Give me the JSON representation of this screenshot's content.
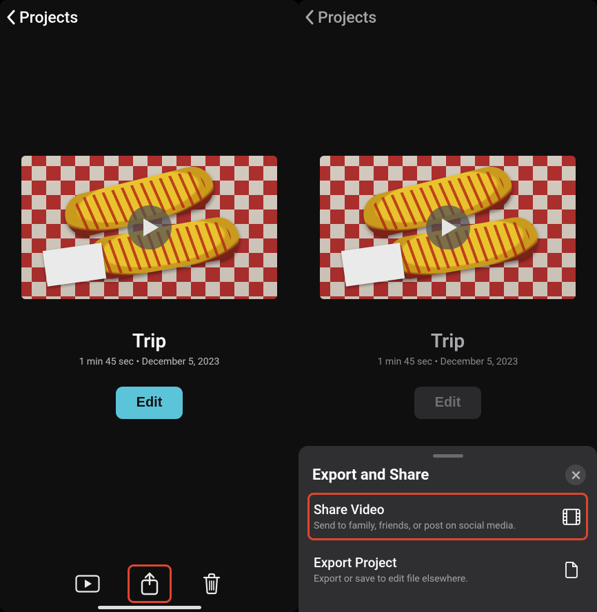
{
  "left": {
    "back_label": "Projects",
    "project": {
      "title": "Trip",
      "meta": "1 min 45 sec • December 5, 2023",
      "edit_label": "Edit"
    }
  },
  "right": {
    "back_label": "Projects",
    "project": {
      "title": "Trip",
      "meta": "1 min 45 sec • December 5, 2023",
      "edit_label": "Edit"
    },
    "sheet": {
      "title": "Export and Share",
      "share": {
        "title": "Share Video",
        "sub": "Send to family, friends, or post on social media."
      },
      "export": {
        "title": "Export Project",
        "sub": "Export or save to edit file elsewhere."
      }
    }
  },
  "icons": {
    "play": "play-icon",
    "share": "share-icon",
    "trash": "trash-icon",
    "preview": "preview-icon",
    "film": "film-icon",
    "file": "file-icon",
    "close": "close-icon"
  }
}
